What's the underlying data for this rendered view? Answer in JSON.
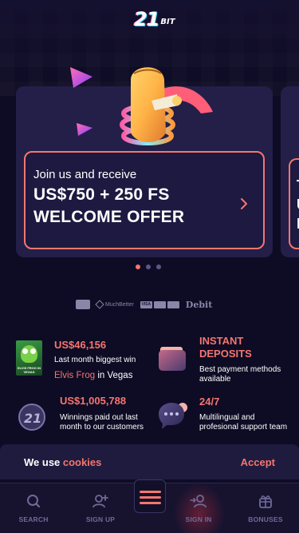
{
  "logo": {
    "number": "21",
    "text": "BIT"
  },
  "promo": {
    "lead": "Join us and receive",
    "amount": "US$750 + 250 FS",
    "title": "WELCOME OFFER",
    "next_preview": "T\nU\nI"
  },
  "carousel": {
    "total": 3,
    "active": 0
  },
  "payments": {
    "muchbetter": "MuchBetter",
    "visa": "VISA",
    "debit": "Debit"
  },
  "features": {
    "win": {
      "amount": "US$46,156",
      "text": "Last month biggest win",
      "game": "Elvis Frog",
      "location_prefix": " in ",
      "location": "Vegas",
      "thumb_label": "ELVIS FROG IN VEGAS"
    },
    "deposits": {
      "title": "INSTANT DEPOSITS",
      "text": "Best payment methods available"
    },
    "paid": {
      "amount": "US$1,005,788",
      "text": "Winnings paid out last month to our customers"
    },
    "support": {
      "title": "24/7",
      "text": "Multilingual and profesional support team"
    }
  },
  "cookie": {
    "prefix": "We use ",
    "link": "cookies",
    "accept": "Accept"
  },
  "nav": {
    "search": "SEARCH",
    "signup": "SIGN UP",
    "signin": "SIGN IN",
    "bonuses": "BONUSES"
  },
  "colors": {
    "accent": "#f4766f",
    "background": "#0e0b24",
    "card": "#231f48",
    "nav_label": "#6f6a98"
  }
}
